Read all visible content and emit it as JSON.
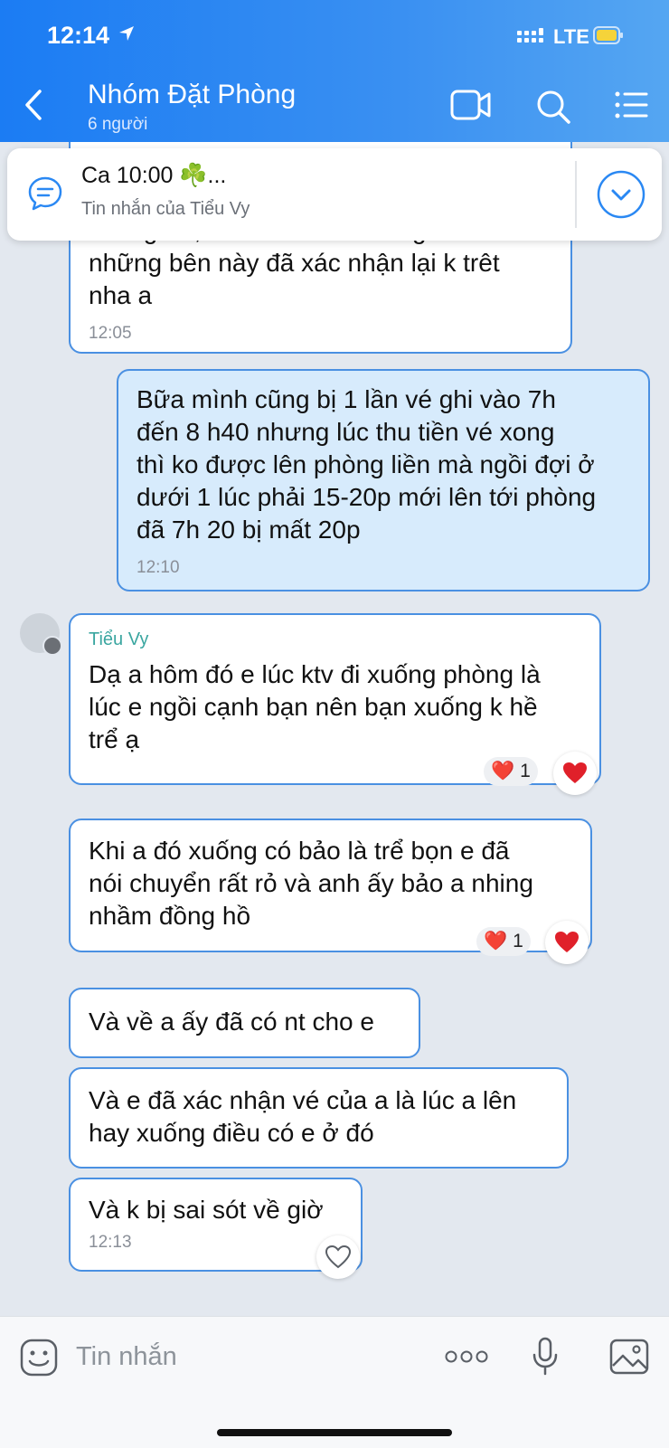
{
  "status_bar": {
    "time": "12:14",
    "network": "LTE"
  },
  "header": {
    "title": "Nhóm Đặt Phòng",
    "subtitle": "6 người"
  },
  "pinned": {
    "title": "Ca 10:00 ☘️...",
    "subtitle": "Tin nhắn của Tiểu Vy"
  },
  "messages": [
    {
      "lines": [
        "xuống trễ, khách đó lúc xuống có nói",
        "những bên này đã xác nhận lại k trêt",
        "nha a"
      ],
      "time": "12:05"
    },
    {
      "lines": [
        "Bữa mình cũng bị 1 lần vé ghi vào 7h",
        "đến 8 h40 nhưng lúc thu tiền vé xong",
        "thì ko được lên phòng liền mà ngồi đợi ở",
        "dưới 1 lúc phải 15-20p mới lên tới phòng",
        "đã 7h 20 bị mất 20p"
      ],
      "time": "12:10"
    },
    {
      "sender": "Tiểu Vy",
      "lines": [
        "Dạ a hôm đó e lúc ktv đi xuống phòng là",
        "lúc e ngồi cạnh bạn nên bạn xuống k hề",
        "trể ạ"
      ],
      "reaction": {
        "emoji": "❤️",
        "count": "1"
      }
    },
    {
      "lines": [
        "Khi a đó xuống có bảo là trể bọn e đã",
        "nói chuyển rất rỏ và anh ấy bảo a nhing",
        "nhầm đồng hồ"
      ],
      "reaction": {
        "emoji": "❤️",
        "count": "1"
      }
    },
    {
      "lines": [
        "Và về a ấy đã có nt cho e"
      ]
    },
    {
      "lines": [
        "Và e đã xác nhận vé của a là lúc a lên",
        "hay xuống điều có e ở đó"
      ]
    },
    {
      "lines": [
        "Và k bị sai sót về giờ"
      ],
      "time": "12:13"
    }
  ],
  "input": {
    "placeholder": "Tin nhắn"
  },
  "icons": [
    "back-icon",
    "video-call-icon",
    "search-icon",
    "menu-icon",
    "chat-bubble-icon",
    "chevron-down-icon",
    "heart-icon",
    "emoji-icon",
    "more-icon",
    "microphone-icon",
    "image-icon"
  ],
  "colors": {
    "header": "#2a88f3",
    "accent": "#4a90e2",
    "my_bubble": "#d7ebfc",
    "sender": "#3aa6a0",
    "heart": "#e0202a"
  }
}
